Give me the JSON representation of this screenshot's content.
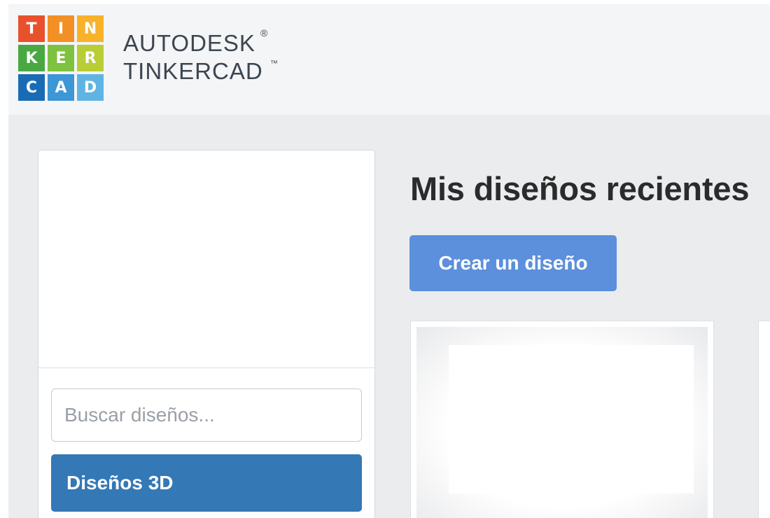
{
  "brand": {
    "logo_letters": [
      {
        "letter": "T",
        "color": "#e8512c"
      },
      {
        "letter": "I",
        "color": "#f29026"
      },
      {
        "letter": "N",
        "color": "#f7b22a"
      },
      {
        "letter": "K",
        "color": "#4aa842"
      },
      {
        "letter": "E",
        "color": "#7fc241"
      },
      {
        "letter": "R",
        "color": "#b9cd36"
      },
      {
        "letter": "C",
        "color": "#1a6bb5"
      },
      {
        "letter": "A",
        "color": "#3d96d6"
      },
      {
        "letter": "D",
        "color": "#5fb4e3"
      }
    ],
    "line1": "AUTODESK",
    "line1_mark": "®",
    "line2": "TINKERCAD",
    "line2_mark": "™"
  },
  "sidebar": {
    "search_placeholder": "Buscar diseños...",
    "nav_items": [
      {
        "label": "Diseños 3D",
        "active": true
      }
    ]
  },
  "main": {
    "title": "Mis diseños recientes",
    "create_button": "Crear un diseño"
  },
  "colors": {
    "accent_button": "#5c8fdc",
    "active_nav": "#3478b6",
    "page_background": "#ebecee",
    "header_background": "#f4f5f7"
  }
}
